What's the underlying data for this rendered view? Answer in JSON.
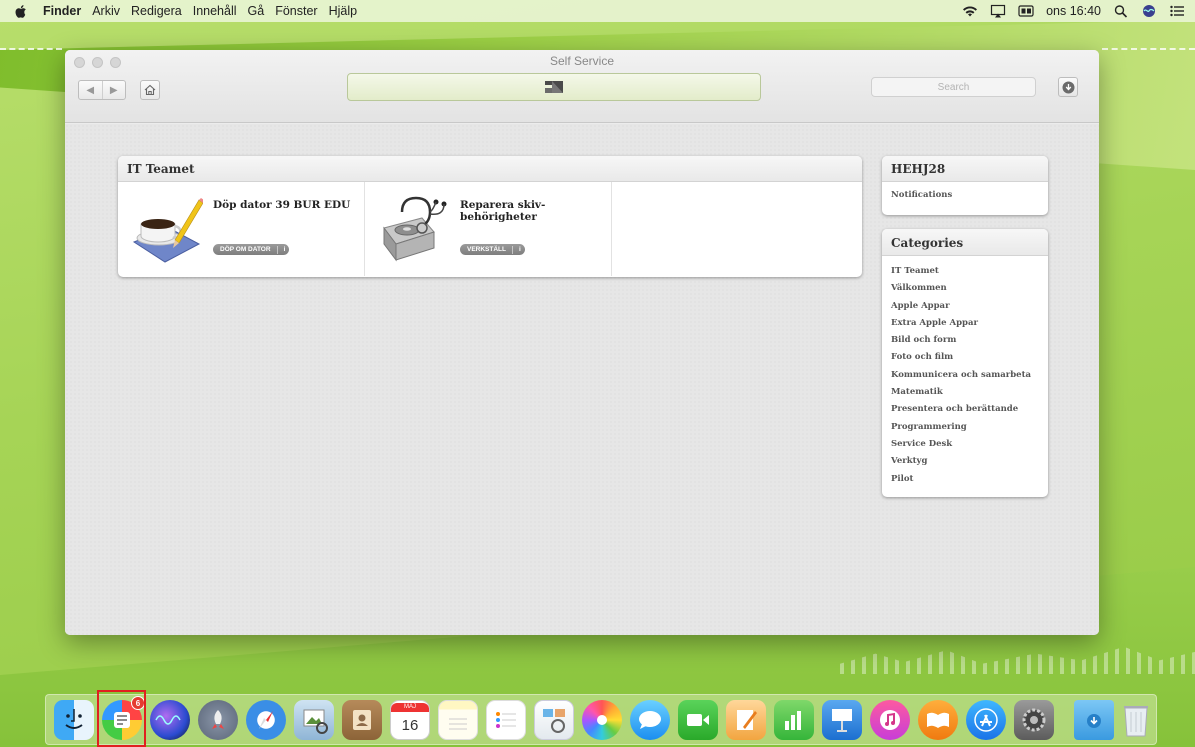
{
  "menubar": {
    "app_name": "Finder",
    "items": [
      "Arkiv",
      "Redigera",
      "Innehåll",
      "Gå",
      "Fönster",
      "Hjälp"
    ],
    "clock": "ons 16:40"
  },
  "window": {
    "title": "Self Service",
    "search_placeholder": "Search"
  },
  "it_panel": {
    "title": "IT Teamet",
    "items": [
      {
        "name": "Döp dator 39 BUR EDU",
        "action": "DÖP OM DATOR"
      },
      {
        "name": "Reparera skiv-behörigheter",
        "action": "VERKSTÄLL"
      }
    ]
  },
  "user_panel": {
    "title": "HEHJ28",
    "link": "Notifications"
  },
  "categories": {
    "title": "Categories",
    "items": [
      "IT Teamet",
      "Välkommen",
      "Apple Appar",
      "Extra Apple Appar",
      "Bild och form",
      "Foto och film",
      "Kommunicera och samarbeta",
      "Matematik",
      "Presentera och berättande",
      "Programmering",
      "Service Desk",
      "Verktyg",
      "Pilot"
    ]
  },
  "dock": {
    "self_service_badge": "6",
    "calendar_month": "MAJ",
    "calendar_day": "16",
    "icons": [
      "finder-icon",
      "self-service-icon",
      "siri-icon",
      "launchpad-icon",
      "safari-icon",
      "preview-icon",
      "contacts-icon",
      "calendar-icon",
      "notes-icon",
      "reminders-icon",
      "photo-booth-icon",
      "photos-icon",
      "messages-icon",
      "facetime-icon",
      "pages-icon",
      "numbers-icon",
      "keynote-icon",
      "itunes-icon",
      "ibooks-icon",
      "app-store-icon",
      "system-preferences-icon",
      "downloads-folder-icon",
      "trash-icon"
    ]
  }
}
